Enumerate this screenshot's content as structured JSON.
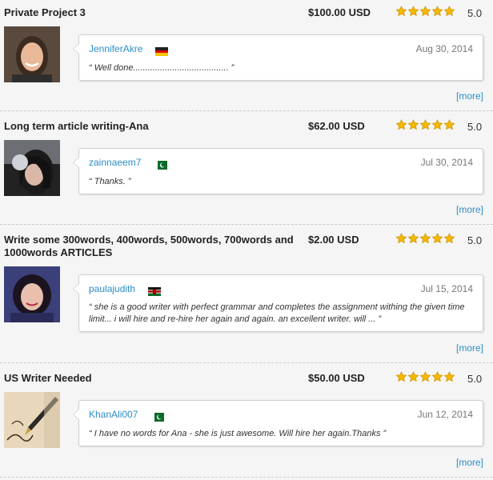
{
  "reviews": [
    {
      "project_title": "Private Project 3",
      "price": "$100.00 USD",
      "rating": "5.0",
      "stars": 5,
      "username": "JenniferAkre",
      "flag_icon": "germany-flag-icon",
      "date": "Aug 30, 2014",
      "comment": "“ Well done....................................... ”",
      "more_label": "[more]"
    },
    {
      "project_title": "Long term article writing-Ana",
      "price": "$62.00 USD",
      "rating": "5.0",
      "stars": 5,
      "username": "zainnaeem7",
      "flag_icon": "pakistan-flag-icon",
      "date": "Jul 30, 2014",
      "comment": "“ Thanks. ”",
      "more_label": "[more]"
    },
    {
      "project_title": "Write some 300words, 400words, 500words, 700words and 1000words ARTICLES",
      "price": "$2.00 USD",
      "rating": "5.0",
      "stars": 5,
      "username": "paulajudith",
      "flag_icon": "kenya-flag-icon",
      "date": "Jul 15, 2014",
      "comment": "“ she is a good writer with perfect grammar and completes the assignment withing the given time limit... i will hire and re-hire her again and again. an excellent writer. will ... ”",
      "more_label": "[more]"
    },
    {
      "project_title": "US Writer Needed",
      "price": "$50.00 USD",
      "rating": "5.0",
      "stars": 5,
      "username": "KhanAli007",
      "flag_icon": "pakistan-flag-icon",
      "date": "Jun 12, 2014",
      "comment": "“ I have no words for Ana - she is just awesome. Will hire her again.Thanks ”",
      "more_label": "[more]"
    }
  ],
  "colors": {
    "link": "#2a8fc6",
    "star_fill": "#f5b800",
    "star_stroke": "#c98f00"
  }
}
